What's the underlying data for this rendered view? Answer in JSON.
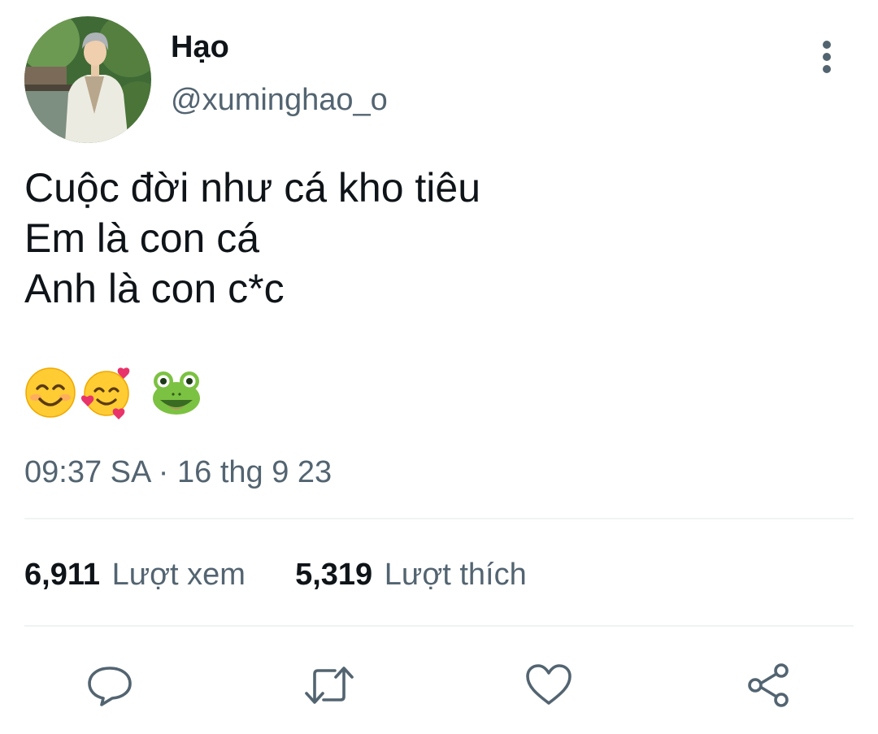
{
  "author": {
    "display_name": "Hạo",
    "handle": "@xuminghao_o"
  },
  "tweet": {
    "lines": [
      "Cuộc đời như cá kho tiêu",
      "Em là con cá",
      "Anh là con c*c"
    ],
    "emojis": [
      "smiling-face-icon",
      "smiling-face-with-hearts-icon",
      "frog-face-icon"
    ],
    "timestamp": "09:37 SA · 16 thg 9 23"
  },
  "stats": {
    "views_count": "6,911",
    "views_label": "Lượt xem",
    "likes_count": "5,319",
    "likes_label": "Lượt thích"
  },
  "actions": [
    "reply-icon",
    "retweet-icon",
    "like-icon",
    "share-icon"
  ],
  "colors": {
    "text_primary": "#0f1419",
    "text_secondary": "#536471",
    "divider": "#eff3f4",
    "icon": "#536471"
  }
}
